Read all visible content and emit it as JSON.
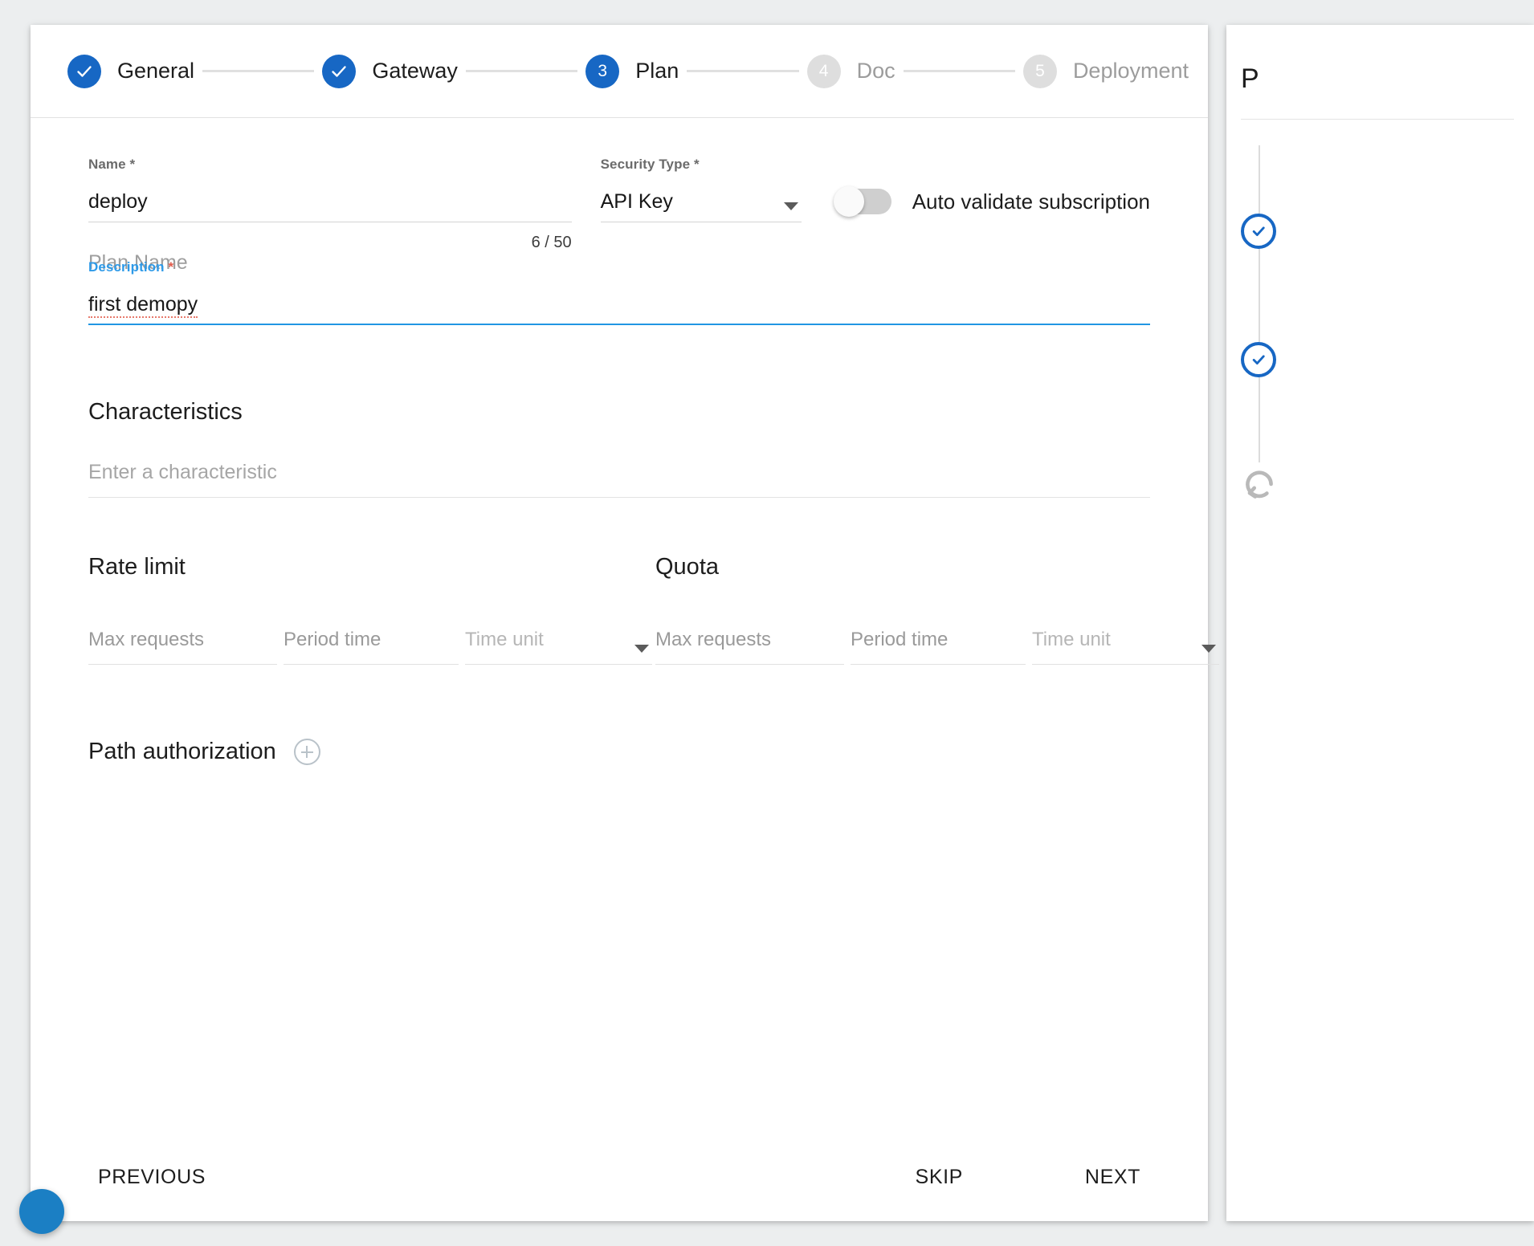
{
  "stepper": {
    "steps": [
      {
        "num": "1",
        "label": "General",
        "state": "done"
      },
      {
        "num": "2",
        "label": "Gateway",
        "state": "done"
      },
      {
        "num": "3",
        "label": "Plan",
        "state": "active"
      },
      {
        "num": "4",
        "label": "Doc",
        "state": "todo"
      },
      {
        "num": "5",
        "label": "Deployment",
        "state": "todo"
      }
    ]
  },
  "form": {
    "name": {
      "label": "Name",
      "required_mark": "*",
      "value": "deploy",
      "counter": "6 / 50",
      "hint": "Plan Name"
    },
    "security_type": {
      "label": "Security Type",
      "required_mark": "*",
      "value": "API Key",
      "options": [
        "API Key"
      ]
    },
    "auto_validate": {
      "label": "Auto validate subscription",
      "state": "off"
    },
    "description": {
      "label": "Description",
      "required_mark": "*",
      "value": "first demopy",
      "focused": true
    },
    "characteristics": {
      "title": "Characteristics",
      "placeholder": "Enter a characteristic",
      "value": ""
    },
    "rate_limit": {
      "title": "Rate limit",
      "max_requests_placeholder": "Max requests",
      "period_time_placeholder": "Period time",
      "time_unit_placeholder": "Time unit"
    },
    "quota": {
      "title": "Quota",
      "max_requests_placeholder": "Max requests",
      "period_time_placeholder": "Period time",
      "time_unit_placeholder": "Time unit"
    },
    "path_authorization": {
      "title": "Path authorization",
      "add_icon": "plus-circle-icon"
    }
  },
  "footer": {
    "previous": "PREVIOUS",
    "skip": "SKIP",
    "next": "NEXT"
  },
  "side_panel": {
    "title": "P",
    "icons": [
      "check-circle-icon",
      "check-circle-icon",
      "refresh-icon"
    ]
  },
  "colors": {
    "accent_blue": "#1767c4",
    "focus_blue": "#2196e3",
    "inactive_gray": "#dedede",
    "label_gray": "#6b6b6b",
    "placeholder_gray": "#a6a6a6",
    "error_red": "#e05b4c",
    "page_bg": "#eceeef",
    "card_bg": "#ffffff"
  }
}
